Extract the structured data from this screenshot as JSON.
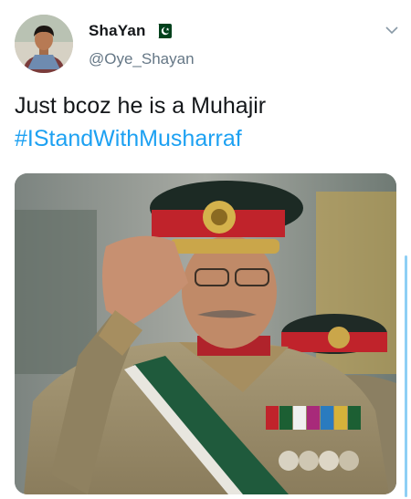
{
  "tweet": {
    "author": {
      "display_name": "ShaYan",
      "handle": "@Oye_Shayan",
      "avatar_icon": "profile-photo",
      "badge_icon": "pakistan-flag-icon"
    },
    "menu_icon": "chevron-down-icon",
    "text_line": "Just bcoz he is a Muhajir",
    "hashtag": "#IStandWithMusharraf",
    "media": {
      "type": "photo",
      "description_icon": "saluting-general-photo"
    }
  },
  "colors": {
    "link": "#1da1f2",
    "text": "#14171a",
    "secondary": "#657786",
    "flag_green": "#01411c"
  }
}
